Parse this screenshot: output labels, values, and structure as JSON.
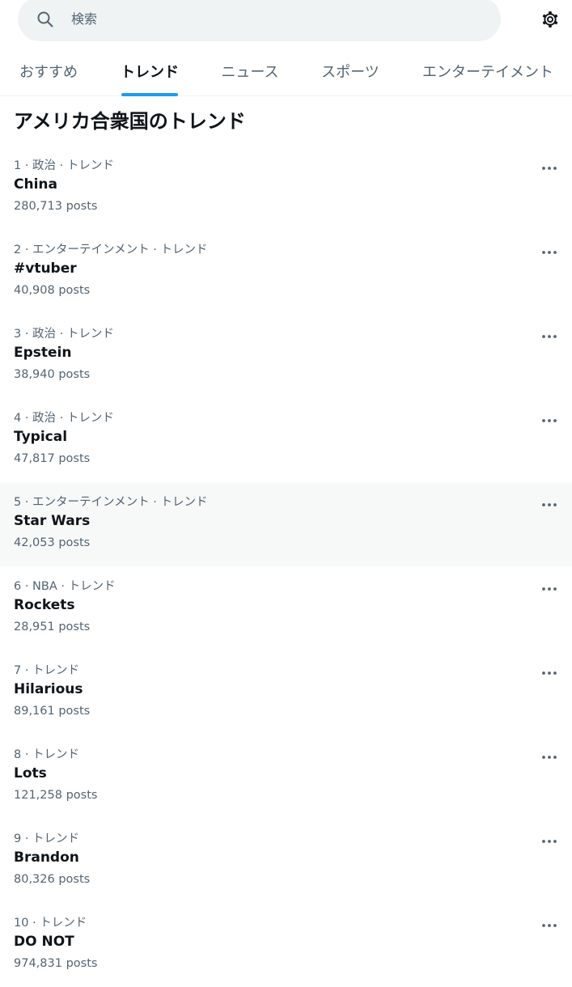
{
  "search": {
    "placeholder": "検索",
    "icon": "search-icon",
    "settings_icon": "gear-icon"
  },
  "tabs": [
    {
      "label": "おすすめ",
      "active": false
    },
    {
      "label": "トレンド",
      "active": true
    },
    {
      "label": "ニュース",
      "active": false
    },
    {
      "label": "スポーツ",
      "active": false
    },
    {
      "label": "エンターテイメント",
      "active": false
    }
  ],
  "section_title": "アメリカ合衆国のトレンド",
  "trends": [
    {
      "meta": "1 · 政治 · トレンド",
      "name": "China",
      "count": "280,713 posts"
    },
    {
      "meta": "2 · エンターテインメント · トレンド",
      "name": "#vtuber",
      "count": "40,908 posts"
    },
    {
      "meta": "3 · 政治 · トレンド",
      "name": "Epstein",
      "count": "38,940 posts"
    },
    {
      "meta": "4 · 政治 · トレンド",
      "name": "Typical",
      "count": "47,817 posts"
    },
    {
      "meta": "5 · エンターテインメント · トレンド",
      "name": "Star Wars",
      "count": "42,053 posts",
      "hovered": true
    },
    {
      "meta": "6 · NBA · トレンド",
      "name": "Rockets",
      "count": "28,951 posts"
    },
    {
      "meta": "7 · トレンド",
      "name": "Hilarious",
      "count": "89,161 posts"
    },
    {
      "meta": "8 · トレンド",
      "name": "Lots",
      "count": "121,258 posts"
    },
    {
      "meta": "9 · トレンド",
      "name": "Brandon",
      "count": "80,326 posts"
    },
    {
      "meta": "10 · トレンド",
      "name": "DO NOT",
      "count": "974,831 posts"
    }
  ],
  "colors": {
    "accent": "#1d9bf0",
    "text_primary": "#0f1419",
    "text_secondary": "#536471",
    "search_bg": "#eff3f4",
    "hover_bg": "#f7f9f9"
  }
}
